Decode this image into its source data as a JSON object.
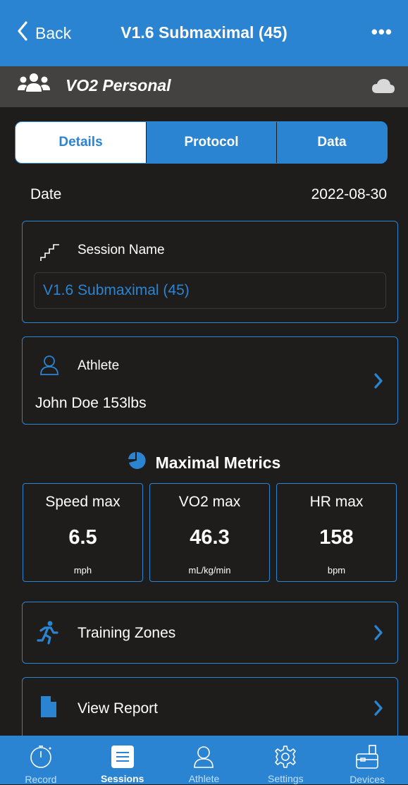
{
  "nav": {
    "back_label": "Back",
    "title": "V1.6 Submaximal (45)",
    "more": "•••"
  },
  "subheader": {
    "title": "VO2 Personal",
    "icon": "people-icon",
    "status_icon": "cloud-icon"
  },
  "tabs": [
    {
      "label": "Details",
      "selected": true
    },
    {
      "label": "Protocol"
    },
    {
      "label": "Data"
    }
  ],
  "details": {
    "date_label": "Date",
    "date_value": "2022-08-30"
  },
  "session": {
    "label": "Session Name",
    "value": "V1.6 Submaximal (45)"
  },
  "athlete": {
    "label": "Athlete",
    "value": "John Doe 153lbs"
  },
  "metrics": {
    "heading": "Maximal Metrics",
    "items": [
      {
        "label": "Speed max",
        "value": "6.5",
        "unit": "mph"
      },
      {
        "label": "VO2 max",
        "value": "46.3",
        "unit": "mL/kg/min"
      },
      {
        "label": "HR max",
        "value": "158",
        "unit": "bpm"
      }
    ]
  },
  "actions": {
    "training_zones": "Training Zones",
    "view_report": "View Report"
  },
  "tabbar": [
    {
      "label": "Record",
      "icon": "stopwatch-icon"
    },
    {
      "label": "Sessions",
      "icon": "list-icon",
      "active": true
    },
    {
      "label": "Athlete",
      "icon": "person-icon"
    },
    {
      "label": "Settings",
      "icon": "gear-icon"
    },
    {
      "label": "Devices",
      "icon": "device-icon"
    }
  ],
  "colors": {
    "accent": "#2a84d2",
    "background": "#1f1d1c",
    "subheader": "#444240"
  }
}
